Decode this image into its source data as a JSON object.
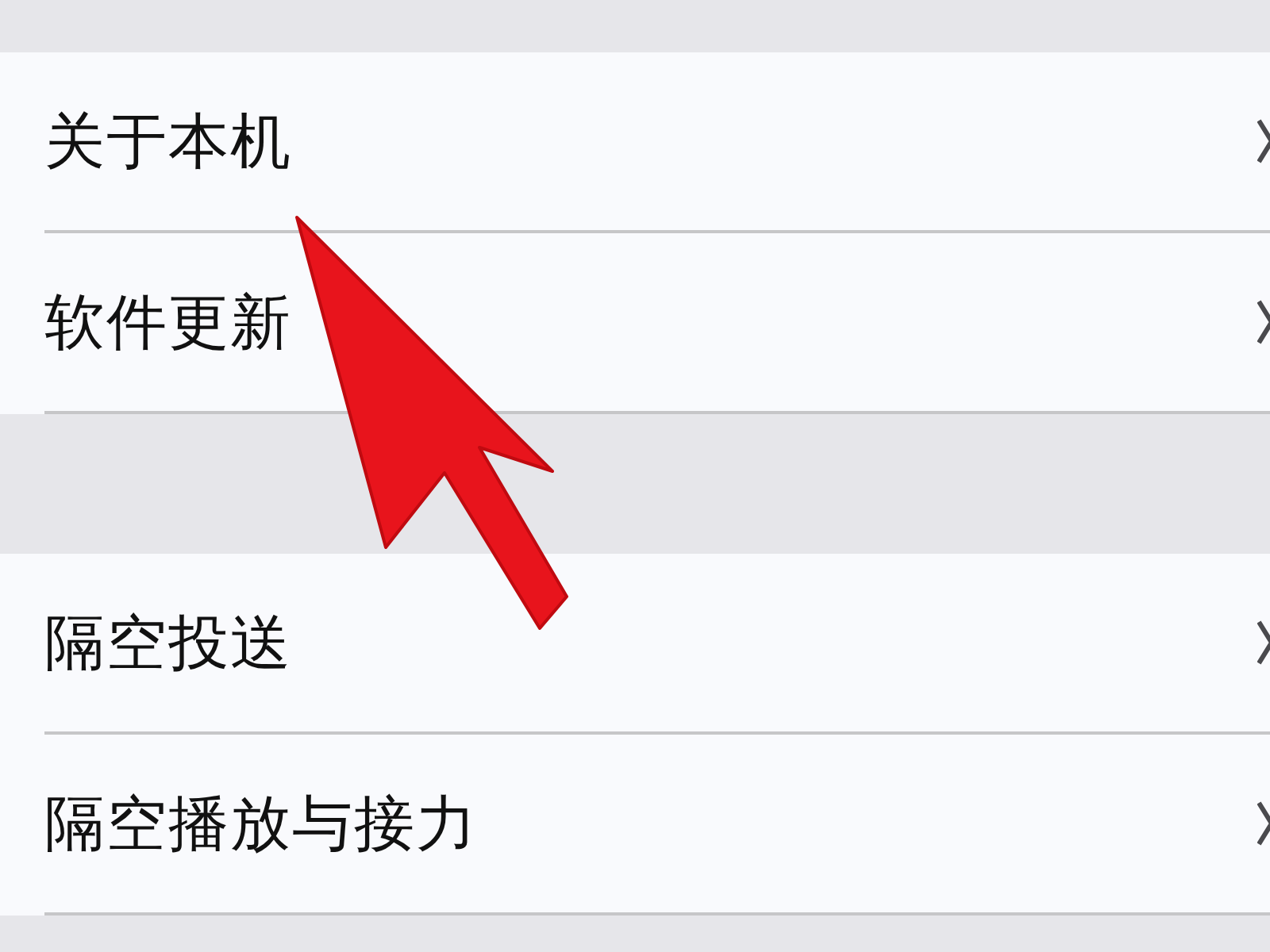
{
  "sections": [
    {
      "rows": [
        {
          "label": "关于本机"
        },
        {
          "label": "软件更新"
        }
      ]
    },
    {
      "rows": [
        {
          "label": "隔空投送"
        },
        {
          "label": "隔空播放与接力"
        }
      ]
    }
  ]
}
